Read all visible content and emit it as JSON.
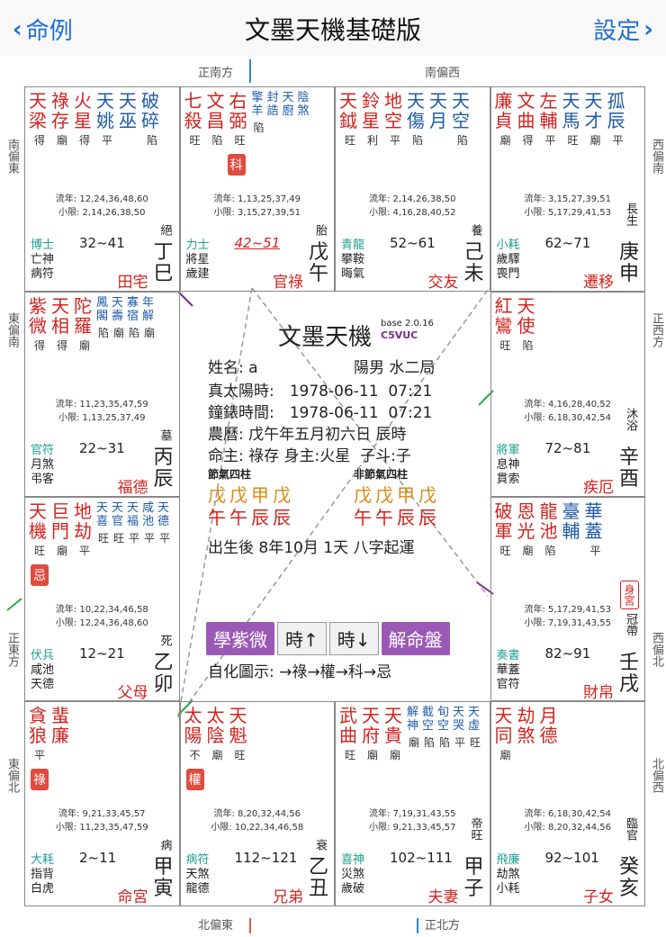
{
  "nav": {
    "back_label": "命例",
    "title": "文墨天機基礎版",
    "settings_label": "設定"
  },
  "dirs": {
    "top_left": "正南方",
    "top_right": "南偏西",
    "bottom_left": "北偏東",
    "bottom_right": "正北方",
    "left1": "南偏東",
    "left2": "東偏南",
    "left3": "正東方",
    "left4": "東偏北",
    "right1": "西偏南",
    "right2": "正西方",
    "right3": "西偏北",
    "right4": "北偏西"
  },
  "center": {
    "title": "文墨天機",
    "version": "base 2.0.16",
    "code": "C5VUC",
    "name": "姓名: a",
    "gender": "陽男 水二局",
    "solar": "真太陽時:　1978-06-11  07:21",
    "clock": "鐘錶時間:　1978-06-11  07:21",
    "lunar": "農曆: 戊午年五月初六日 辰時",
    "lords": "命主: 祿存 身主:火星  子斗:子",
    "jieqi_label": "節氣四柱",
    "nonjieqi_label": "非節氣四柱",
    "pillars1_top": "戊戊甲戊",
    "pillars1_bot": "午午辰辰",
    "pillars2_top": "戊戊甲戊",
    "pillars2_bot": "午午辰辰",
    "luck": "出生後 8年10月 1天 八字起運",
    "btn_ziwei": "學紫微",
    "btn_time_up": "時↑",
    "btn_time_down": "時↓",
    "btn_chart": "解命盤",
    "legend": "自化圖示: →祿→權→科→忌"
  },
  "cells": [
    {
      "stars": [
        "天梁",
        "祿存",
        "火星",
        "天姚",
        "天巫",
        "破碎"
      ],
      "bright": [
        "得",
        "廟",
        "得",
        "平",
        "",
        "陷"
      ],
      "liunian": "流年: 12,24,36,48,60",
      "xiaoxian": "小限: 2,14,26,38,50",
      "spirit1": "博士",
      "spirit2": "亡神",
      "spirit3": "病符",
      "age": "32~41",
      "stage": "絕",
      "ganzhi": "丁巳",
      "palace": "田宅"
    },
    {
      "stars": [
        "七殺",
        "文昌",
        "右弼",
        "擎羊",
        "封誥",
        "天廚",
        "陰煞"
      ],
      "bright": [
        "旺",
        "陷",
        "旺",
        "陷",
        "",
        "",
        ""
      ],
      "hua": "科",
      "liunian": "流年: 1,13,25,37,49",
      "xiaoxian": "小限: 3,15,27,39,51",
      "spirit1": "力士",
      "spirit2": "將星",
      "spirit3": "歲建",
      "age": "42~51",
      "stage": "胎",
      "ganzhi": "戊午",
      "palace": "官祿"
    },
    {
      "stars": [
        "天鉞",
        "鈴星",
        "地空",
        "天傷",
        "天月",
        "天空"
      ],
      "bright": [
        "旺",
        "利",
        "平",
        "陷",
        "",
        "陷"
      ],
      "liunian": "流年: 2,14,26,38,50",
      "xiaoxian": "小限: 4,16,28,40,52",
      "spirit1": "青龍",
      "spirit2": "攀鞍",
      "spirit3": "晦氣",
      "age": "52~61",
      "stage": "養",
      "ganzhi": "己未",
      "palace": "交友"
    },
    {
      "stars": [
        "廉貞",
        "文曲",
        "左輔",
        "天馬",
        "天才",
        "孤辰"
      ],
      "bright": [
        "廟",
        "得",
        "平",
        "旺",
        "廟",
        "平"
      ],
      "liunian": "流年: 3,15,27,39,51",
      "xiaoxian": "小限: 5,17,29,41,53",
      "spirit1": "小耗",
      "spirit2": "歲驛",
      "spirit3": "喪門",
      "age": "62~71",
      "stage": "長生",
      "ganzhi": "庚申",
      "palace": "遷移"
    },
    {
      "stars": [
        "紫微",
        "天相",
        "陀羅",
        "鳳閣",
        "天壽",
        "寡宿",
        "年解"
      ],
      "bright": [
        "得",
        "得",
        "廟",
        "陷",
        "廟",
        "陷",
        "廟"
      ],
      "liunian": "流年: 11,23,35,47,59",
      "xiaoxian": "小限: 1,13,25,37,49",
      "spirit1": "官符",
      "spirit2": "月煞",
      "spirit3": "弔客",
      "age": "22~31",
      "stage": "墓",
      "ganzhi": "丙辰",
      "palace": "福德"
    },
    {
      "stars": [
        "紅鸞",
        "天使"
      ],
      "bright": [
        "旺",
        "陷"
      ],
      "liunian": "流年: 4,16,28,40,52",
      "xiaoxian": "小限: 6,18,30,42,54",
      "spirit1": "將軍",
      "spirit2": "息神",
      "spirit3": "貫索",
      "age": "72~81",
      "stage": "沐浴",
      "ganzhi": "辛酉",
      "palace": "疾厄"
    },
    {
      "stars": [
        "天機",
        "巨門",
        "地劫",
        "天喜",
        "天官",
        "天福",
        "咸池",
        "天德"
      ],
      "bright": [
        "旺",
        "廟",
        "平",
        "旺",
        "旺",
        "平",
        "平",
        "平"
      ],
      "hua": "忌",
      "liunian": "流年: 10,22,34,46,58",
      "xiaoxian": "小限: 12,24,36,48,60",
      "spirit1": "伏兵",
      "spirit2": "咸池",
      "spirit3": "天德",
      "age": "12~21",
      "stage": "死",
      "ganzhi": "乙卯",
      "palace": "父母"
    },
    {
      "stars": [
        "破軍",
        "恩光",
        "龍池",
        "臺輔",
        "華蓋"
      ],
      "bright": [
        "旺",
        "廟",
        "陷",
        "",
        "平"
      ],
      "liunian": "流年: 5,17,29,41,53",
      "xiaoxian": "小限: 7,19,31,43,55",
      "spirit1": "奏書",
      "spirit2": "華蓋",
      "spirit3": "官符",
      "age": "82~91",
      "stage": "冠帶",
      "ganzhi": "壬戌",
      "palace": "財帛",
      "shen": "身宮"
    },
    {
      "stars": [
        "貪狼",
        "蜚廉"
      ],
      "bright": [
        "平",
        ""
      ],
      "hua": "祿",
      "liunian": "流年: 9,21,33,45,57",
      "xiaoxian": "小限: 11,23,35,47,59",
      "spirit1": "大耗",
      "spirit2": "指背",
      "spirit3": "白虎",
      "age": "2~11",
      "stage": "病",
      "ganzhi": "甲寅",
      "palace": "命宮"
    },
    {
      "stars": [
        "太陽",
        "太陰",
        "天魁"
      ],
      "bright": [
        "不",
        "廟",
        "旺"
      ],
      "hua": "權",
      "liunian": "流年: 8,20,32,44,56",
      "xiaoxian": "小限: 10,22,34,46,58",
      "spirit1": "病符",
      "spirit2": "天煞",
      "spirit3": "龍德",
      "age": "112~121",
      "stage": "衰",
      "ganzhi": "乙丑",
      "palace": "兄弟"
    },
    {
      "stars": [
        "武曲",
        "天府",
        "天貴",
        "解神",
        "截空",
        "旬空",
        "天哭",
        "天虛"
      ],
      "bright": [
        "旺",
        "廟",
        "廟",
        "廟",
        "陷",
        "陷",
        "平",
        "旺"
      ],
      "liunian": "流年: 7,19,31,43,55",
      "xiaoxian": "小限: 9,21,33,45,57",
      "spirit1": "喜神",
      "spirit2": "災煞",
      "spirit3": "歲破",
      "age": "102~111",
      "stage": "帝旺",
      "ganzhi": "甲子",
      "palace": "夫妻"
    },
    {
      "stars": [
        "天同",
        "劫煞",
        "月德"
      ],
      "bright": [
        "廟",
        "",
        ""
      ],
      "liunian": "流年: 6,18,30,42,54",
      "xiaoxian": "小限: 8,20,32,44,56",
      "spirit1": "飛廉",
      "spirit2": "劫煞",
      "spirit3": "小耗",
      "age": "92~101",
      "stage": "臨官",
      "ganzhi": "癸亥",
      "palace": "子女"
    }
  ],
  "colors": {
    "red": "#d2231f",
    "blue": "#1e5aa8",
    "green": "#1e9e8f",
    "purple": "#9b59b6",
    "nav_blue": "#1f6fd6"
  }
}
